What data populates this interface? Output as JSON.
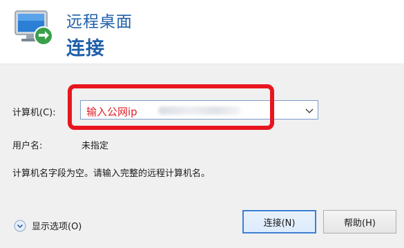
{
  "header": {
    "title": "远程桌面",
    "subtitle": "连接"
  },
  "form": {
    "computer_label": "计算机(C):",
    "computer_value": "输入公网ip",
    "username_label": "用户名:",
    "username_value": "未指定",
    "message": "计算机名字段为空。请输入完整的远程计算机名。"
  },
  "footer": {
    "show_options_label": "显示选项(O)",
    "connect_label": "连接(N)",
    "help_label": "帮助(H)"
  },
  "colors": {
    "title": "#1f5fa8",
    "annotation_red": "#e8151f",
    "panel_bg": "#f0f0f0"
  },
  "icons": [
    "remote-desktop-icon",
    "chevron-down-icon",
    "expand-options-icon"
  ]
}
